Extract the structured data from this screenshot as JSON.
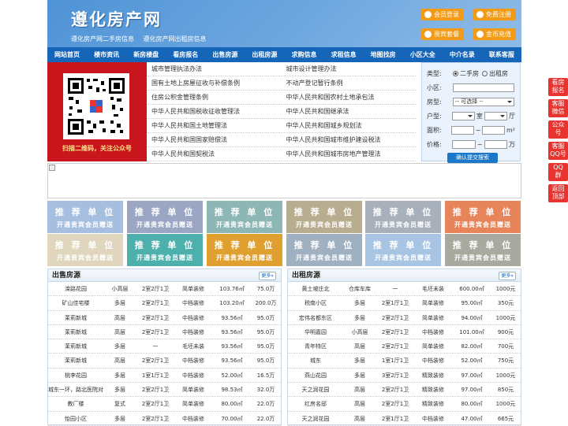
{
  "header": {
    "logo": "遵化房产网",
    "subtitle": [
      "遵化房产网二手房信息",
      "遵化房产网出租房信息"
    ],
    "buttons": [
      "会员登录",
      "免费注册",
      "贵宾套餐",
      "金币充值"
    ],
    "accent": "#f39a17"
  },
  "nav": [
    "网站首页",
    "楼市资讯",
    "新房楼盘",
    "看房报名",
    "出售房源",
    "出租房源",
    "求购信息",
    "求租信息",
    "地图找房",
    "小区大全",
    "中介名录",
    "联系客服"
  ],
  "qr": {
    "caption": "扫描二维码，关注公众号"
  },
  "links": [
    [
      "城市管理执法办法",
      "城市设计管理办法"
    ],
    [
      "国有土地上房屋征收与补偿条例",
      "不动产登记暂行条例"
    ],
    [
      "住房公积金管理条例",
      "中华人民共和国农村土地承包法"
    ],
    [
      "中华人民共和国税收征收管理法",
      "中华人民共和国继承法"
    ],
    [
      "中华人民共和国土地管理法",
      "中华人民共和国城乡规划法"
    ],
    [
      "中华人民共和国国家赔偿法",
      "中华人民共和国城市维护建设税法"
    ],
    [
      "中华人民共和国契税法",
      "中华人民共和国城市房地产管理法"
    ]
  ],
  "search": {
    "type_label": "类型:",
    "type_options": [
      "二手房",
      "出租房"
    ],
    "community_label": "小区:",
    "house_label": "房型:",
    "house_select": "-- 可选择 --",
    "layout_label": "户型:",
    "room": "室",
    "hall": "厅",
    "area_label": "面积:",
    "area_unit": "m²",
    "price_label": "价格:",
    "price_unit": "万",
    "tilde": "~",
    "submit": "确认提交搜索"
  },
  "ads": {
    "title": "推 荐 单 位",
    "subtitle": "开通贵宾会员赠送",
    "colors": [
      "#a6bfe0",
      "#9aa6c4",
      "#8db7b4",
      "#b9ad8f",
      "#a8b1bb",
      "#e8845a",
      "#e0d6bd",
      "#4db0ad",
      "#e0a030",
      "#9fb0c0",
      "#a8c4e3",
      "#a9a9a0"
    ]
  },
  "sale": {
    "title": "出售房源",
    "more": "更多»",
    "rows": [
      [
        "滦路花园",
        "小高层",
        "2室2厅1卫",
        "简单装修",
        "103.76㎡",
        "75.0万"
      ],
      [
        "矿山佳宅楼",
        "多层",
        "2室2厅1卫",
        "中档装修",
        "103.20㎡",
        "200.0万"
      ],
      [
        "茉莉新城",
        "高层",
        "2室2厅1卫",
        "中档装修",
        "93.56㎡",
        "95.0万"
      ],
      [
        "茉莉新城",
        "高层",
        "2室2厅1卫",
        "中档装修",
        "93.56㎡",
        "95.0万"
      ],
      [
        "茉莉新城",
        "多层",
        "一",
        "毛坯未装",
        "93.56㎡",
        "95.0万"
      ],
      [
        "茉莉新城",
        "高层",
        "2室2厅1卫",
        "中档装修",
        "93.56㎡",
        "95.0万"
      ],
      [
        "桃李花园",
        "多层",
        "1室1厅1卫",
        "中档装修",
        "52.00㎡",
        "16.5万"
      ],
      [
        "城东一环，路北医院对",
        "多层",
        "2室2厅1卫",
        "简单装修",
        "98.53㎡",
        "32.0万"
      ],
      [
        "教厂楼",
        "复式",
        "2室2厅1卫",
        "简单装修",
        "80.00㎡",
        "22.0万"
      ],
      [
        "怡园小区",
        "多层",
        "2室2厅1卫",
        "中档装修",
        "70.00㎡",
        "22.0万"
      ]
    ]
  },
  "rent": {
    "title": "出租房源",
    "more": "更多»",
    "rows": [
      [
        "黄土坡庄北",
        "仓库车库",
        "一",
        "毛坯未装",
        "600.00㎡",
        "1000元"
      ],
      [
        "税南小区",
        "多层",
        "2室1厅1卫",
        "简单装修",
        "95.00㎡",
        "350元"
      ],
      [
        "宏伟名都东区",
        "多层",
        "2室2厅1卫",
        "简单装修",
        "94.00㎡",
        "1000元"
      ],
      [
        "华明嘉园",
        "小高层",
        "2室2厅1卫",
        "中档装修",
        "101.00㎡",
        "900元"
      ],
      [
        "青年特区",
        "高层",
        "2室2厅1卫",
        "简单装修",
        "82.00㎡",
        "700元"
      ],
      [
        "城东",
        "多层",
        "1室1厅1卫",
        "中档装修",
        "52.00㎡",
        "750元"
      ],
      [
        "燕山花园",
        "多层",
        "3室2厅1卫",
        "精致装修",
        "97.00㎡",
        "1000元"
      ],
      [
        "天之润花园",
        "高层",
        "2室2厅1卫",
        "精致装修",
        "97.00㎡",
        "850元"
      ],
      [
        "红房名邸",
        "高层",
        "2室2厅1卫",
        "精致装修",
        "80.00㎡",
        "1000元"
      ],
      [
        "天之润花园",
        "高层",
        "2室1厅1卫",
        "中档装修",
        "47.00㎡",
        "665元"
      ]
    ]
  },
  "sidebar": [
    [
      "看房",
      "报名"
    ],
    [
      "客服",
      "微信"
    ],
    [
      "公众",
      "号"
    ],
    [
      "客服",
      "QQ号"
    ],
    [
      "QQ",
      "群"
    ],
    [
      "返回",
      "顶部"
    ]
  ]
}
